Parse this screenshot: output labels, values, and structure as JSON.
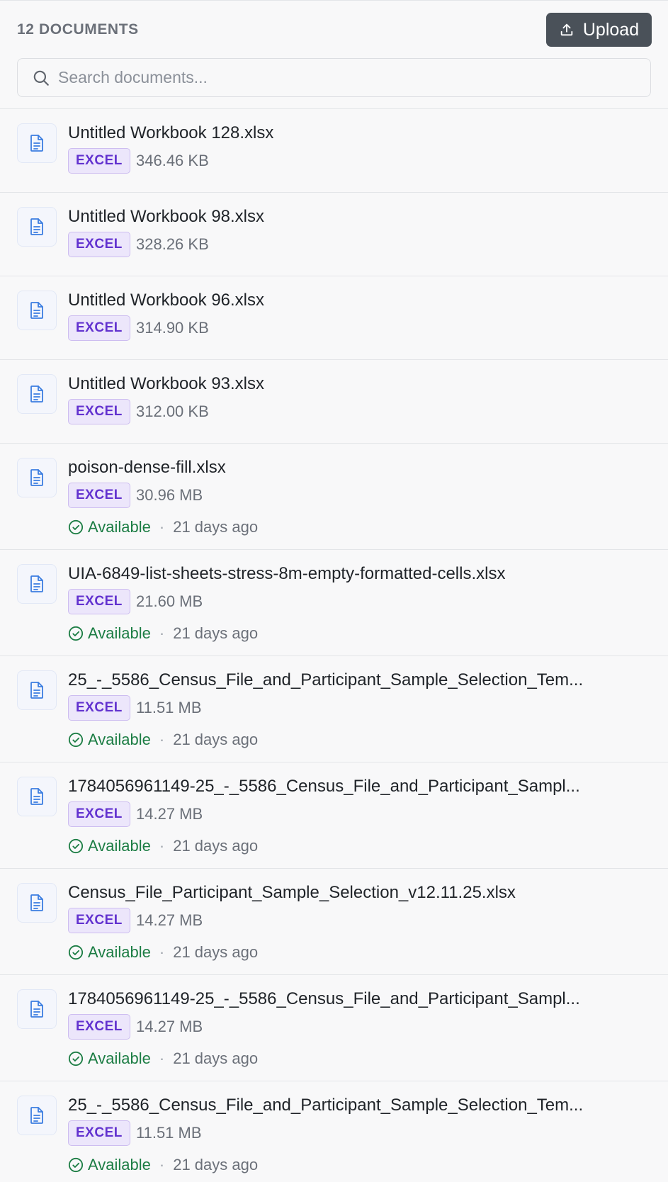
{
  "header": {
    "doc_count": "12 DOCUMENTS",
    "upload_label": "Upload"
  },
  "search": {
    "placeholder": "Search documents...",
    "value": ""
  },
  "colors": {
    "accent_dark": "#4a5159",
    "badge_purple": "#6232cf",
    "status_green": "#1c7d44",
    "icon_blue": "#3b7de0"
  },
  "documents": [
    {
      "name": "Untitled Workbook 128.xlsx",
      "type": "EXCEL",
      "size": "346.46 KB",
      "status": "",
      "age": ""
    },
    {
      "name": "Untitled Workbook 98.xlsx",
      "type": "EXCEL",
      "size": "328.26 KB",
      "status": "",
      "age": ""
    },
    {
      "name": "Untitled Workbook 96.xlsx",
      "type": "EXCEL",
      "size": "314.90 KB",
      "status": "",
      "age": ""
    },
    {
      "name": "Untitled Workbook 93.xlsx",
      "type": "EXCEL",
      "size": "312.00 KB",
      "status": "",
      "age": ""
    },
    {
      "name": "poison-dense-fill.xlsx",
      "type": "EXCEL",
      "size": "30.96 MB",
      "status": "Available",
      "age": "21 days ago"
    },
    {
      "name": "UIA-6849-list-sheets-stress-8m-empty-formatted-cells.xlsx",
      "type": "EXCEL",
      "size": "21.60 MB",
      "status": "Available",
      "age": "21 days ago"
    },
    {
      "name": "25_-_5586_Census_File_and_Participant_Sample_Selection_Tem...",
      "type": "EXCEL",
      "size": "11.51 MB",
      "status": "Available",
      "age": "21 days ago"
    },
    {
      "name": "1784056961149-25_-_5586_Census_File_and_Participant_Sampl...",
      "type": "EXCEL",
      "size": "14.27 MB",
      "status": "Available",
      "age": "21 days ago"
    },
    {
      "name": "Census_File_Participant_Sample_Selection_v12.11.25.xlsx",
      "type": "EXCEL",
      "size": "14.27 MB",
      "status": "Available",
      "age": "21 days ago"
    },
    {
      "name": "1784056961149-25_-_5586_Census_File_and_Participant_Sampl...",
      "type": "EXCEL",
      "size": "14.27 MB",
      "status": "Available",
      "age": "21 days ago"
    },
    {
      "name": "25_-_5586_Census_File_and_Participant_Sample_Selection_Tem...",
      "type": "EXCEL",
      "size": "11.51 MB",
      "status": "Available",
      "age": "21 days ago"
    }
  ],
  "icons": {
    "upload": "upload-icon",
    "search": "search-icon",
    "file": "document-icon",
    "status": "check-circle-icon"
  }
}
